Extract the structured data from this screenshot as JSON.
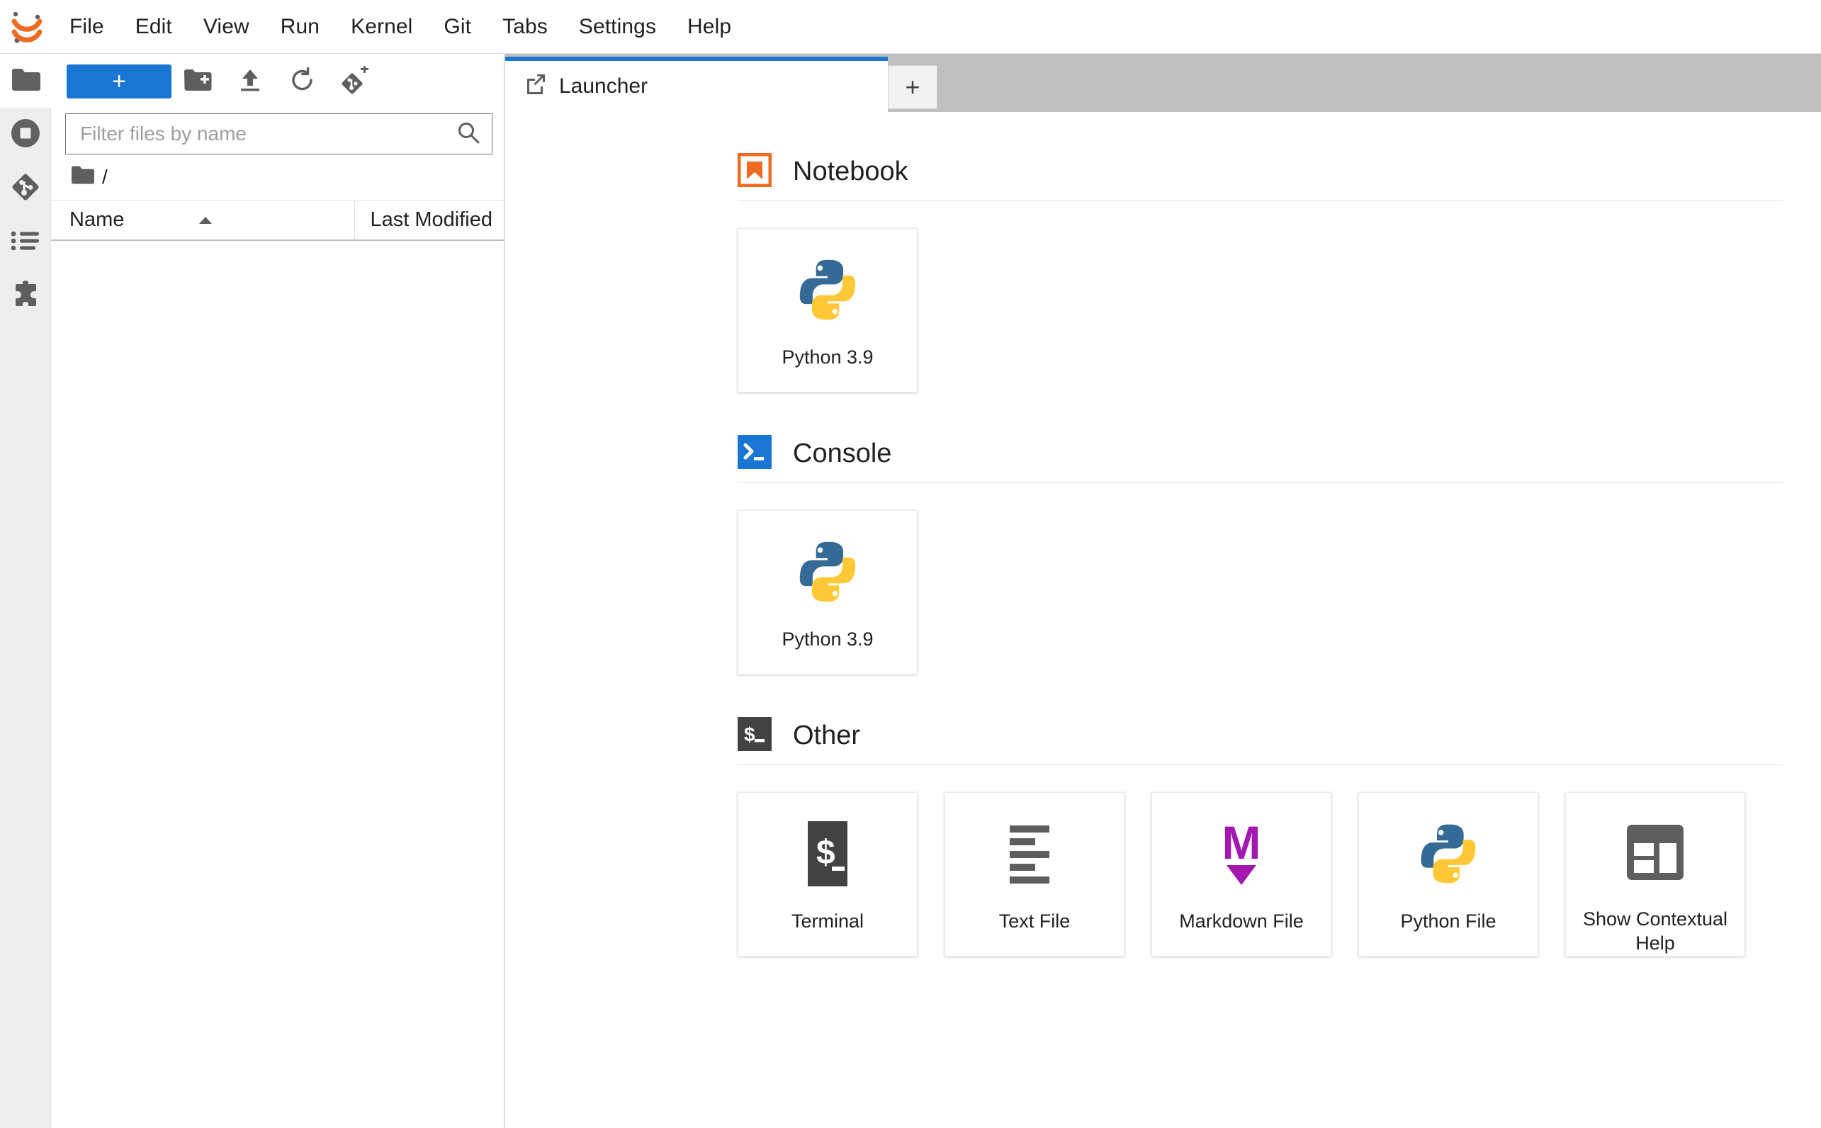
{
  "app": {
    "logo_icon": "jupyter-logo-icon"
  },
  "menubar": {
    "items": [
      {
        "label": "File"
      },
      {
        "label": "Edit"
      },
      {
        "label": "View"
      },
      {
        "label": "Run"
      },
      {
        "label": "Kernel"
      },
      {
        "label": "Git"
      },
      {
        "label": "Tabs"
      },
      {
        "label": "Settings"
      },
      {
        "label": "Help"
      }
    ]
  },
  "sidebar_rail": {
    "items": [
      {
        "name": "file-browser",
        "icon": "folder-icon",
        "active": true
      },
      {
        "name": "running-sessions",
        "icon": "stop-circle-icon",
        "active": false
      },
      {
        "name": "git-panel",
        "icon": "git-icon",
        "active": false
      },
      {
        "name": "table-of-contents",
        "icon": "list-icon",
        "active": false
      },
      {
        "name": "extension-manager",
        "icon": "puzzle-piece-icon",
        "active": false
      }
    ]
  },
  "filebrowser": {
    "toolbar": {
      "new_launcher_label": "+",
      "new_folder_icon": "new-folder-icon",
      "upload_icon": "upload-icon",
      "refresh_icon": "refresh-icon",
      "git_clone_icon": "git-clone-icon"
    },
    "filter": {
      "value": "",
      "placeholder": "Filter files by name",
      "search_icon": "search-icon"
    },
    "breadcrumb": {
      "root_icon": "folder-icon",
      "path": "/"
    },
    "columns": {
      "name": "Name",
      "sort_arrow": "▲",
      "last_modified": "Last Modified"
    },
    "rows": []
  },
  "tabbar": {
    "tabs": [
      {
        "label": "Launcher",
        "icon": "external-link-icon",
        "active": true
      }
    ],
    "add_tab_label": "+"
  },
  "launcher": {
    "sections": [
      {
        "id": "notebook",
        "title": "Notebook",
        "icon": "notebook-bookmark-icon",
        "icon_color": "#EE6C21",
        "cards": [
          {
            "label": "Python 3.9",
            "icon": "python-logo-icon"
          }
        ]
      },
      {
        "id": "console",
        "title": "Console",
        "icon": "console-prompt-icon",
        "icon_color": "#1976D2",
        "cards": [
          {
            "label": "Python 3.9",
            "icon": "python-logo-icon"
          }
        ]
      },
      {
        "id": "other",
        "title": "Other",
        "icon": "terminal-dollar-icon",
        "icon_color": "#424242",
        "cards": [
          {
            "label": "Terminal",
            "icon": "terminal-dollar-icon"
          },
          {
            "label": "Text File",
            "icon": "text-lines-icon"
          },
          {
            "label": "Markdown File",
            "icon": "markdown-m-icon"
          },
          {
            "label": "Python File",
            "icon": "python-logo-icon"
          },
          {
            "label": "Show Contextual Help",
            "icon": "contextual-help-icon"
          }
        ]
      }
    ]
  },
  "colors": {
    "accent_blue": "#1976D2",
    "jupyter_orange": "#EE6C21",
    "markdown_purple": "#A218B0",
    "terminal_dark": "#424242",
    "python_blue": "#366A96",
    "python_yellow": "#FFC836",
    "rail_gray": "#EEEEEE",
    "tabbar_gray": "#BFBFBF"
  }
}
